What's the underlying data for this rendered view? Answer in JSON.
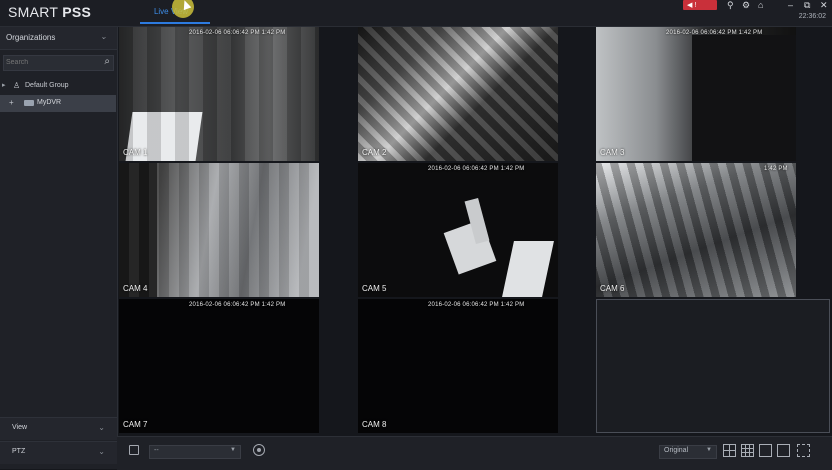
{
  "app": {
    "logo_prefix": "SMART ",
    "logo_bold": "PSS",
    "active_tab": "Live View",
    "clock": "22:36:02"
  },
  "titlebar_icons": [
    "user-icon",
    "settings-icon",
    "lock-icon",
    "minimize-icon",
    "restore-icon",
    "close-icon"
  ],
  "sidebar": {
    "header": "Organizations",
    "search_placeholder": "Search",
    "group_label": "Default Group",
    "device_label": "MyDVR",
    "view_label": "View",
    "ptz_label": "PTZ"
  },
  "cameras": [
    {
      "label": "CAM 1",
      "osd": "2016-02-06 06:06:42 PM   1:42 PM"
    },
    {
      "label": "CAM 2",
      "osd": ""
    },
    {
      "label": "CAM 3",
      "osd": "2016-02-06 06:06:42 PM   1:42 PM"
    },
    {
      "label": "CAM 4",
      "osd": ""
    },
    {
      "label": "CAM 5",
      "osd": "2016-02-06 06:06:42 PM   1:42 PM"
    },
    {
      "label": "CAM 6",
      "osd": "1:42 PM"
    },
    {
      "label": "CAM 7",
      "osd": "2016-02-06 06:06:42 PM   1:42 PM"
    },
    {
      "label": "CAM 8",
      "osd": "2016-02-06 06:06:42 PM   1:42 PM"
    }
  ],
  "bottombar": {
    "preset_value": "--",
    "display_value": "Original"
  },
  "colors": {
    "accent": "#2d7be0",
    "alarm": "#c9303a",
    "background": "#15171c"
  }
}
